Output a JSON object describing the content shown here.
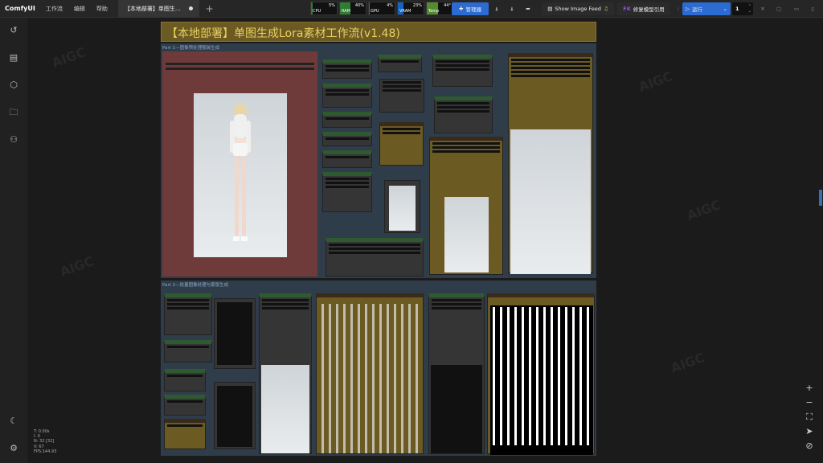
{
  "app": {
    "brand": "ComfyUI"
  },
  "menu": [
    "工作流",
    "编辑",
    "帮助"
  ],
  "tab": {
    "title": "【本地部署】单图生..."
  },
  "monitors": [
    {
      "label": "CPU",
      "pct": "5%",
      "value": 0.05,
      "color": "#2e7d32"
    },
    {
      "label": "RAM",
      "pct": "40%",
      "value": 0.4,
      "color": "#2e7d32"
    },
    {
      "label": "GPU",
      "pct": "4%",
      "value": 0.04,
      "color": "#2e7d32"
    },
    {
      "label": "VRAM",
      "pct": "23%",
      "value": 0.23,
      "color": "#1565c0"
    },
    {
      "label": "Temp",
      "pct": "44°",
      "value": 0.44,
      "color": "#558b2f"
    }
  ],
  "toolbar": {
    "manager": "管理器",
    "image_feed": "Show Image Feed",
    "fix_model": "修复模型引用",
    "run": "运行",
    "queue_count": "1"
  },
  "workflow": {
    "title": "【本地部署】单图生成Lora素材工作流(v1.48)",
    "group1_title": "Part 1—图像预处理服装生成",
    "group2_title": "Part 2—批量图像处理与蒙版生成"
  },
  "stats": [
    "T: 0.00s",
    "I: 0",
    "N: 32 [32]",
    "V: 67",
    "FPS:144.93"
  ],
  "colors": {
    "accent_blue": "#2c6bd1",
    "title_bar": "#6b5a22",
    "group_bg": "#2f3d4b"
  }
}
